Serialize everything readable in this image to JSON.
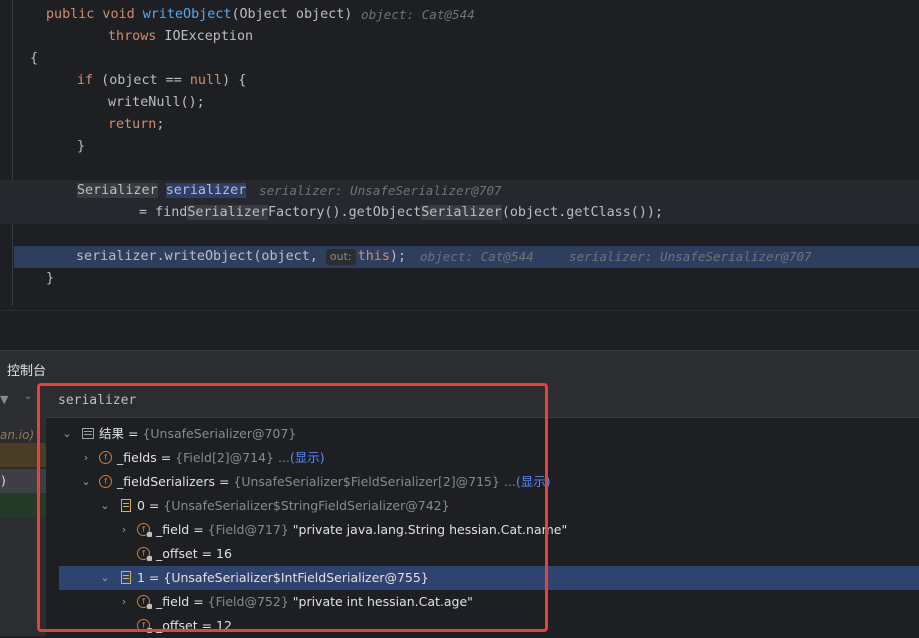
{
  "code": {
    "line1": {
      "kw": "public void ",
      "fn": "writeObject",
      "rest": "(Object object)",
      "hint": "object: Cat@544"
    },
    "line2": {
      "kw": "throws",
      "rest": " IOException"
    },
    "line3": "{",
    "line4": {
      "kw1": "if",
      "mid": " (object == ",
      "kw2": "null",
      "end": ") {"
    },
    "line5": "writeNull();",
    "line6": {
      "kw": "return",
      "end": ";"
    },
    "line7": "}",
    "line9": {
      "type": "Serializer",
      "var": "serializer",
      "hint": "serializer: UnsafeSerializer@707"
    },
    "line10": {
      "pre": "= find",
      "m1": "Serializer",
      "mid": "Factory().getObject",
      "m2": "Serializer",
      "end": "(object.getClass());"
    },
    "line12": {
      "pre": "serializer.writeObject(object,",
      "param": "out:",
      "kw": "this",
      "end": ");",
      "hint1": "object: Cat@544",
      "hint2": "serializer: UnsafeSerializer@707"
    },
    "line13": "}"
  },
  "tool": {
    "title": "控制台"
  },
  "left_panel": {
    "dropdown": "▼",
    "chevron": "⌄",
    "frame_text": "an.io)",
    "frame_text2": ")"
  },
  "evaluate": {
    "expression": "serializer"
  },
  "tree": [
    {
      "arrow": "⌄",
      "name": "结果",
      "eq": " = ",
      "val": "{UnsafeSerializer@707}"
    },
    {
      "arrow": "›",
      "icon": "f",
      "name": "_fields",
      "eq": " = ",
      "val": "{Field[2]@714}",
      "link": "...(显示)"
    },
    {
      "arrow": "⌄",
      "icon": "f",
      "name": "_fieldSerializers",
      "eq": " = ",
      "val": "{UnsafeSerializer$FieldSerializer[2]@715}",
      "link": "...(显示)"
    },
    {
      "arrow": "⌄",
      "name": "0",
      "eq": " = ",
      "val": "{UnsafeSerializer$StringFieldSerializer@742}"
    },
    {
      "arrow": "›",
      "icon": "f",
      "name": "_field",
      "eq": " = ",
      "val": "{Field@717}",
      "str": "\"private java.lang.String hessian.Cat.name\""
    },
    {
      "icon": "f",
      "name": "_offset",
      "eq": " = ",
      "str": "16"
    },
    {
      "arrow": "⌄",
      "name": "1",
      "eq": " = ",
      "str": "{UnsafeSerializer$IntFieldSerializer@755}"
    },
    {
      "arrow": "›",
      "icon": "f",
      "name": "_field",
      "eq": " = ",
      "val": "{Field@752}",
      "str": "\"private int hessian.Cat.age\""
    },
    {
      "icon": "f",
      "name": "_offset",
      "eq": " = ",
      "str": "12"
    }
  ]
}
